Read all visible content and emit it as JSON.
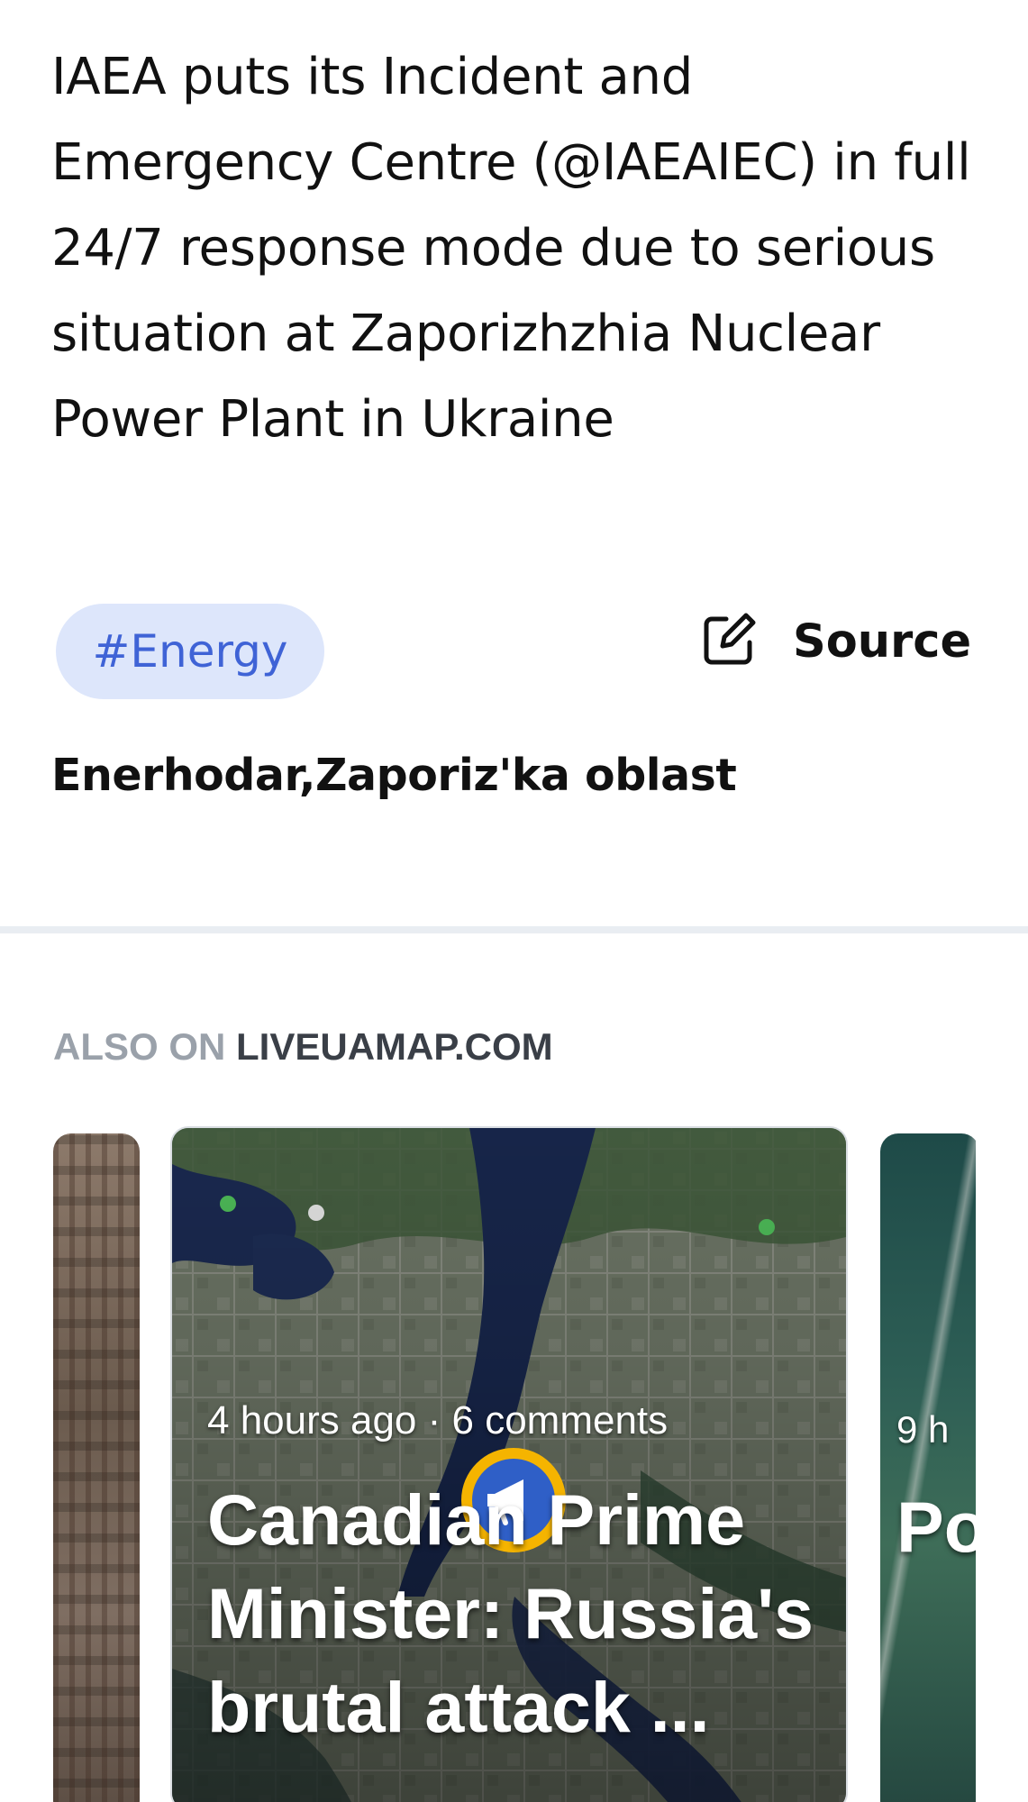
{
  "article": {
    "headline": "IAEA puts its Incident and Emergency Centre (@IAEAIEC) in full 24/7 response mode due to serious situation at Zaporizhzhia Nuclear Power Plant in Ukraine",
    "tag": "#Energy",
    "source_label": "Source",
    "location": "Enerhodar,Zaporiz'ka oblast"
  },
  "also_on": {
    "prefix": "ALSO ON",
    "site": "LIVEUAMAP.COM"
  },
  "cards": {
    "main": {
      "meta": "4 hours ago · 6 comments",
      "title": "Canadian Prime Minister: Russia's brutal attack ..."
    },
    "right": {
      "meta": "9 h",
      "title": "Po di re"
    }
  },
  "colors": {
    "tag_bg": "#dde6fb",
    "tag_text": "#3f63d6",
    "marker_ring": "#f5b400",
    "marker_fill": "#2f5fc7"
  },
  "icons": {
    "source": "external-edit-icon",
    "marker": "megaphone-icon"
  }
}
